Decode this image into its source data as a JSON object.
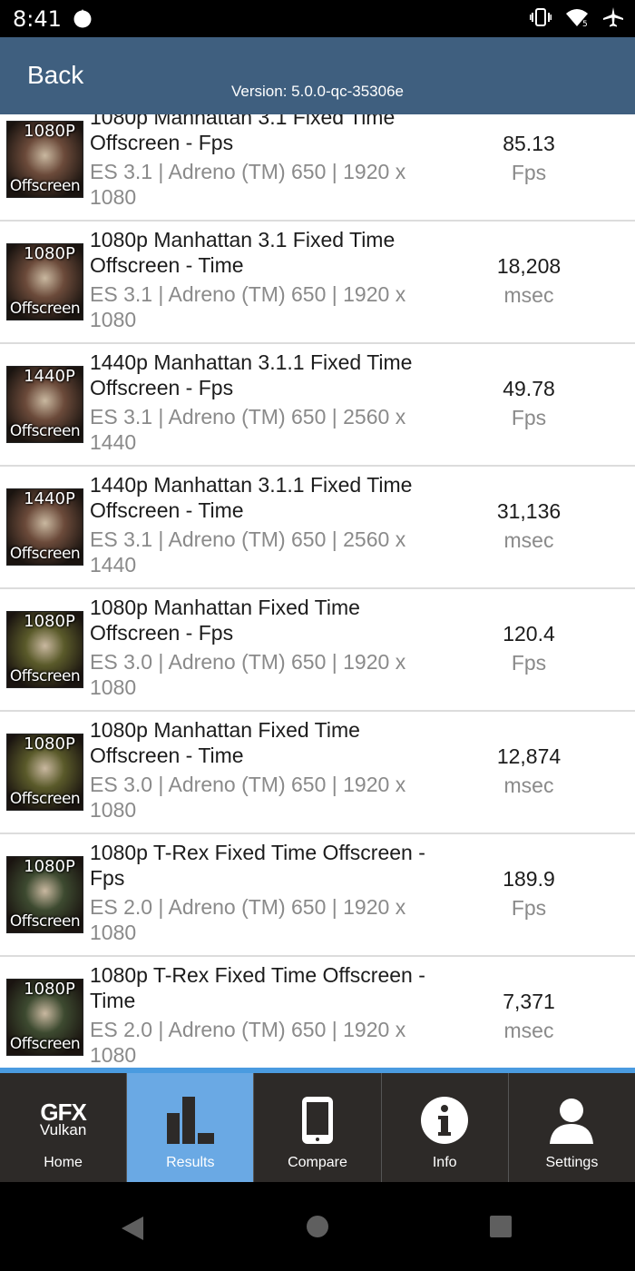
{
  "status_bar": {
    "time": "8:41",
    "icons": [
      "notification-dot-icon",
      "vibrate-icon",
      "wifi-icon",
      "airplane-icon"
    ]
  },
  "header": {
    "back_label": "Back",
    "version": "Version: 5.0.0-qc-35306e"
  },
  "results": [
    {
      "thumb_top": "1080P",
      "thumb_bottom": "Offscreen",
      "title": "1080p Manhattan 3.1 Fixed Time Offscreen - Fps",
      "subtitle": "ES 3.1 | Adreno (TM) 650 | 1920 x 1080",
      "value": "85.13",
      "unit": "Fps",
      "thumb_color": "#6b4a3a"
    },
    {
      "thumb_top": "1080P",
      "thumb_bottom": "Offscreen",
      "title": "1080p Manhattan 3.1 Fixed Time Offscreen - Time",
      "subtitle": "ES 3.1 | Adreno (TM) 650 | 1920 x 1080",
      "value": "18,208",
      "unit": "msec",
      "thumb_color": "#6b4a3a"
    },
    {
      "thumb_top": "1440P",
      "thumb_bottom": "Offscreen",
      "title": "1440p Manhattan 3.1.1 Fixed Time Offscreen - Fps",
      "subtitle": "ES 3.1 | Adreno (TM) 650 | 2560 x 1440",
      "value": "49.78",
      "unit": "Fps",
      "thumb_color": "#6b4a3a"
    },
    {
      "thumb_top": "1440P",
      "thumb_bottom": "Offscreen",
      "title": "1440p Manhattan 3.1.1 Fixed Time Offscreen - Time",
      "subtitle": "ES 3.1 | Adreno (TM) 650 | 2560 x 1440",
      "value": "31,136",
      "unit": "msec",
      "thumb_color": "#6b4a3a"
    },
    {
      "thumb_top": "1080P",
      "thumb_bottom": "Offscreen",
      "title": "1080p Manhattan Fixed Time Offscreen - Fps",
      "subtitle": "ES 3.0 | Adreno (TM) 650 | 1920 x 1080",
      "value": "120.4",
      "unit": "Fps",
      "thumb_color": "#5a5a2a"
    },
    {
      "thumb_top": "1080P",
      "thumb_bottom": "Offscreen",
      "title": "1080p Manhattan Fixed Time Offscreen - Time",
      "subtitle": "ES 3.0 | Adreno (TM) 650 | 1920 x 1080",
      "value": "12,874",
      "unit": "msec",
      "thumb_color": "#5a5a2a"
    },
    {
      "thumb_top": "1080P",
      "thumb_bottom": "Offscreen",
      "title": "1080p T-Rex Fixed Time Offscreen - Fps",
      "subtitle": "ES 2.0 | Adreno (TM) 650 | 1920 x 1080",
      "value": "189.9",
      "unit": "Fps",
      "thumb_color": "#3d4a30"
    },
    {
      "thumb_top": "1080P",
      "thumb_bottom": "Offscreen",
      "title": "1080p T-Rex Fixed Time Offscreen - Time",
      "subtitle": "ES 2.0 | Adreno (TM) 650 | 1920 x 1080",
      "value": "7,371",
      "unit": "msec",
      "thumb_color": "#3d4a30"
    }
  ],
  "tabs": {
    "home": {
      "label": "Home",
      "logo_line1": "GFX",
      "logo_line2": "Vulkan"
    },
    "results": {
      "label": "Results",
      "icon": "bar-chart-icon",
      "active": true
    },
    "compare": {
      "label": "Compare",
      "icon": "phone-icon"
    },
    "info": {
      "label": "Info",
      "icon": "info-icon"
    },
    "settings": {
      "label": "Settings",
      "icon": "user-icon"
    }
  },
  "colors": {
    "header_bg": "#3f5f7f",
    "tab_active": "#6aa9e4",
    "tab_bg": "#2d2a28"
  }
}
